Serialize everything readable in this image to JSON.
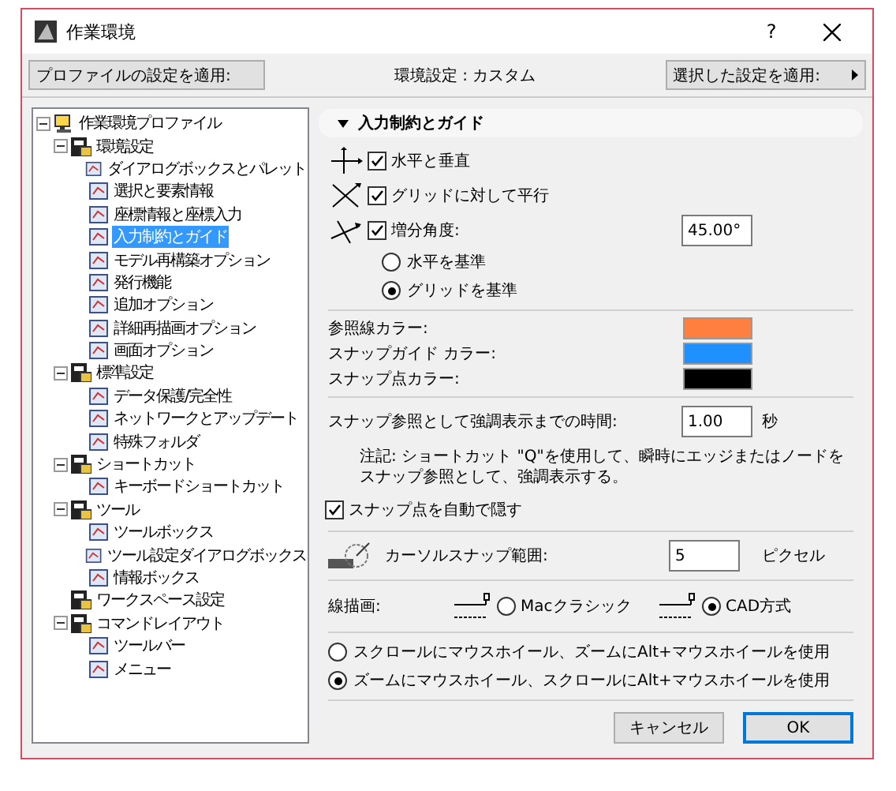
{
  "window": {
    "title": "作業環境",
    "help": "?"
  },
  "toolbar": {
    "apply_profile": "プロファイルの設定を適用:",
    "current": "環境設定 : カスタム",
    "apply_selected": "選択した設定を適用:"
  },
  "tree": [
    {
      "label": "作業環境プロファイル",
      "expanded": true,
      "selected": false,
      "children": [
        {
          "label": "環境設定",
          "expanded": true,
          "selected": false,
          "children": [
            {
              "label": "ダイアログボックスとパレット",
              "selected": false
            },
            {
              "label": "選択と要素情報",
              "selected": false
            },
            {
              "label": "座標情報と座標入力",
              "selected": false
            },
            {
              "label": "入力制約とガイド",
              "selected": true
            },
            {
              "label": "モデル再構築オプション",
              "selected": false
            },
            {
              "label": "発行機能",
              "selected": false
            },
            {
              "label": "追加オプション",
              "selected": false
            },
            {
              "label": "詳細再描画オプション",
              "selected": false
            },
            {
              "label": "画面オプション",
              "selected": false
            }
          ]
        },
        {
          "label": "標準設定",
          "expanded": true,
          "selected": false,
          "children": [
            {
              "label": "データ保護/完全性",
              "selected": false
            },
            {
              "label": "ネットワークとアップデート",
              "selected": false
            },
            {
              "label": "特殊フォルダ",
              "selected": false
            }
          ]
        },
        {
          "label": "ショートカット",
          "expanded": true,
          "selected": false,
          "children": [
            {
              "label": "キーボードショートカット",
              "selected": false
            }
          ]
        },
        {
          "label": "ツール",
          "expanded": true,
          "selected": false,
          "children": [
            {
              "label": "ツールボックス",
              "selected": false
            },
            {
              "label": "ツール設定ダイアログボックス",
              "selected": false
            },
            {
              "label": "情報ボックス",
              "selected": false
            }
          ]
        },
        {
          "label": "ワークスペース設定",
          "selected": false
        },
        {
          "label": "コマンドレイアウト",
          "expanded": true,
          "selected": false,
          "children": [
            {
              "label": "ツールバー",
              "selected": false
            },
            {
              "label": "メニュー",
              "selected": false
            }
          ]
        }
      ]
    }
  ],
  "section": {
    "title": "入力制約とガイド",
    "expanded": true
  },
  "constraints": [
    {
      "label": "水平と垂直",
      "checked": true
    },
    {
      "label": "グリッドに対して平行",
      "checked": true
    },
    {
      "label": "増分角度:",
      "checked": true,
      "value": "45.00°"
    }
  ],
  "angle_reference": [
    {
      "label": "水平を基準",
      "selected": false
    },
    {
      "label": "グリッドを基準",
      "selected": true
    }
  ],
  "colors": [
    {
      "label": "参照線カラー:",
      "color": "#ff7f3f"
    },
    {
      "label": "スナップガイド カラー:",
      "color": "#1e90ff"
    },
    {
      "label": "スナップ点カラー:",
      "color": "#000000"
    }
  ],
  "highlight_time": {
    "label": "スナップ参照として強調表示までの時間:",
    "value": "1.00",
    "unit": "秒"
  },
  "note": "注記: ショートカット \"Q\"を使用して、瞬時にエッジまたはノードをスナップ参照として、強調表示する。",
  "auto_hide": {
    "label": "スナップ点を自動で隠す",
    "checked": true
  },
  "cursor_snap": {
    "label": "カーソルスナップ範囲:",
    "value": "5",
    "unit": "ピクセル"
  },
  "line_drawing": {
    "label": "線描画:",
    "options": [
      {
        "label": "Macクラシック",
        "selected": false
      },
      {
        "label": "CAD方式",
        "selected": true
      }
    ]
  },
  "wheel_options": [
    {
      "label": "スクロールにマウスホイール、ズームにAlt+マウスホイールを使用",
      "selected": false
    },
    {
      "label": "ズームにマウスホイール、スクロールにAlt+マウスホイールを使用",
      "selected": true
    }
  ],
  "buttons": [
    {
      "label": "キャンセル",
      "kind": "normal"
    },
    {
      "label": "OK",
      "kind": "default"
    }
  ]
}
